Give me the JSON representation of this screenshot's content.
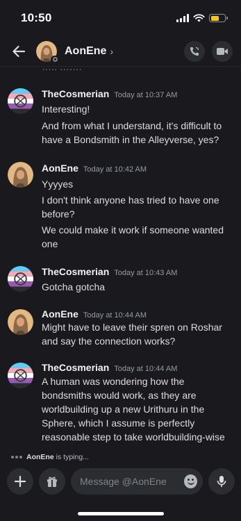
{
  "status_bar": {
    "time": "10:50"
  },
  "header": {
    "name": "AonEne",
    "chevron": "›"
  },
  "clipped_text": "….. …….",
  "messages": [
    {
      "author": "TheCosmerian",
      "time": "Today at 10:37 AM",
      "avatar": "flag-avatar",
      "lines": [
        "Interesting!",
        "And from what I understand, it's difficult to",
        "have a Bondsmith in the Alleyverse, yes?"
      ]
    },
    {
      "author": "AonEne",
      "time": "Today at 10:42 AM",
      "avatar": "portrait-avatar",
      "lines": [
        "Yyyyes",
        "I don't think anyone has tried to have one",
        "before?",
        "We could make it work if someone wanted",
        "one"
      ]
    },
    {
      "author": "TheCosmerian",
      "time": "Today at 10:43 AM",
      "avatar": "flag-avatar",
      "lines": [
        "Gotcha gotcha"
      ]
    },
    {
      "author": "AonEne",
      "time": "Today at 10:44 AM",
      "avatar": "portrait-avatar",
      "lines": [
        "Might have to leave their spren on Roshar",
        "and say the connection works?"
      ]
    },
    {
      "author": "TheCosmerian",
      "time": "Today at 10:44 AM",
      "avatar": "flag-avatar",
      "lines": [
        "A human was wondering how the",
        "bondsmiths would work, as they are",
        "worldbuilding up a new Urithuru in the",
        "Sphere, which I assume is perfectly",
        "reasonable step to take worldbuilding-wise"
      ]
    }
  ],
  "typing": {
    "user": "AonEne",
    "text": "is typing..."
  },
  "composer": {
    "placeholder": "Message @AonEne"
  },
  "colors": {
    "background": "#1a1a1e",
    "button": "#2b2d31",
    "battery": "#f5c518"
  }
}
